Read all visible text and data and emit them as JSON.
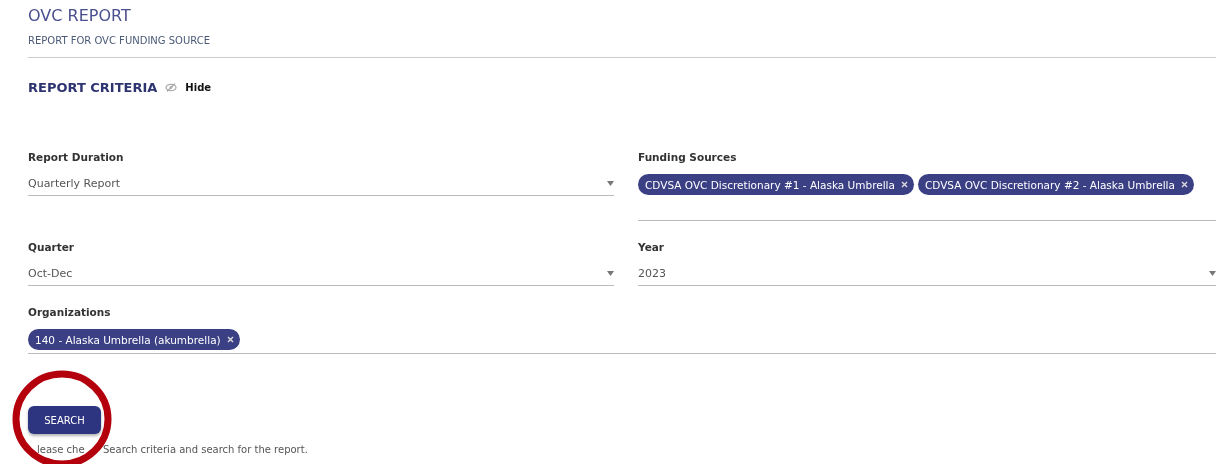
{
  "header": {
    "title": "OVC REPORT",
    "subtitle": "REPORT FOR OVC FUNDING SOURCE"
  },
  "criteria": {
    "title": "REPORT CRITERIA",
    "toggle": "Hide"
  },
  "fields": [
    {
      "kind": "select",
      "label": "Report Duration",
      "value": "Quarterly Report"
    },
    {
      "kind": "chips",
      "label": "Funding Sources",
      "chips": [
        "CDVSA OVC Discretionary #1 - Alaska Umbrella",
        "CDVSA OVC Discretionary #2 - Alaska Umbrella"
      ]
    },
    {
      "kind": "select",
      "label": "Quarter",
      "value": "Oct-Dec"
    },
    {
      "kind": "select",
      "label": "Year",
      "value": "2023"
    },
    {
      "kind": "chips",
      "label": "Organizations",
      "chips": [
        "140 - Alaska Umbrella (akumbrella)"
      ]
    }
  ],
  "search_button": "SEARCH",
  "hint": [
    "lease che",
    "Search criteria and search for the report."
  ]
}
